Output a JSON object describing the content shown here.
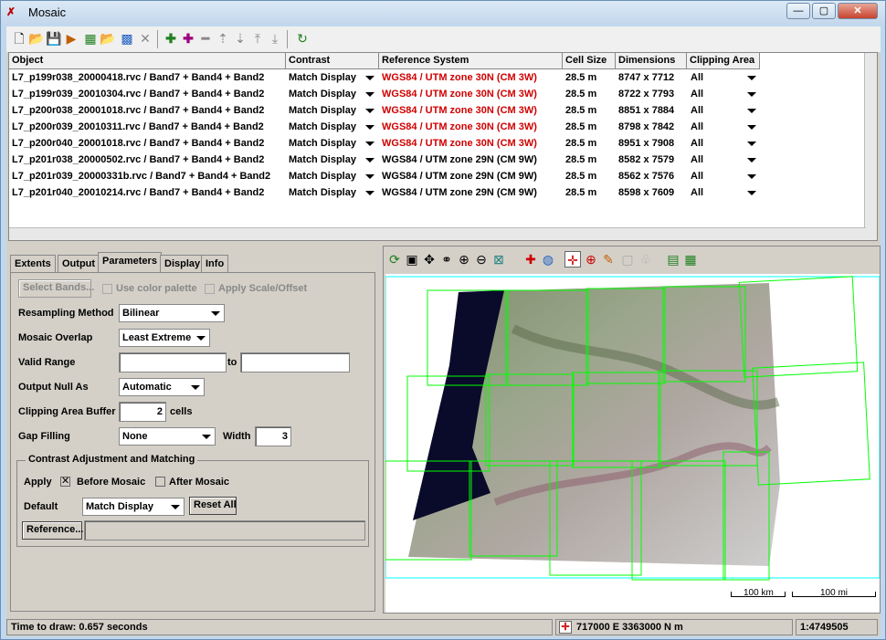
{
  "window": {
    "title": "Mosaic",
    "min": "—",
    "max": "▢",
    "close": "✕"
  },
  "grid": {
    "headers": [
      "Object",
      "Contrast",
      "Reference System",
      "Cell Size",
      "Dimensions",
      "Clipping Area"
    ],
    "rows": [
      {
        "object": "L7_p199r038_20000418.rvc / Band7 + Band4 + Band2",
        "contrast": "Match Display",
        "ref": "WGS84 / UTM zone 30N (CM 3W)",
        "ref_red": true,
        "cell": "28.5 m",
        "dim": "8747 x 7712",
        "clip": "All"
      },
      {
        "object": "L7_p199r039_20010304.rvc / Band7 + Band4 + Band2",
        "contrast": "Match Display",
        "ref": "WGS84 / UTM zone 30N (CM 3W)",
        "ref_red": true,
        "cell": "28.5 m",
        "dim": "8722 x 7793",
        "clip": "All"
      },
      {
        "object": "L7_p200r038_20001018.rvc / Band7 + Band4 + Band2",
        "contrast": "Match Display",
        "ref": "WGS84 / UTM zone 30N (CM 3W)",
        "ref_red": true,
        "cell": "28.5 m",
        "dim": "8851 x 7884",
        "clip": "All"
      },
      {
        "object": "L7_p200r039_20010311.rvc / Band7 + Band4 + Band2",
        "contrast": "Match Display",
        "ref": "WGS84 / UTM zone 30N (CM 3W)",
        "ref_red": true,
        "cell": "28.5 m",
        "dim": "8798 x 7842",
        "clip": "All"
      },
      {
        "object": "L7_p200r040_20001018.rvc / Band7 + Band4 + Band2",
        "contrast": "Match Display",
        "ref": "WGS84 / UTM zone 30N (CM 3W)",
        "ref_red": true,
        "cell": "28.5 m",
        "dim": "8951 x 7908",
        "clip": "All"
      },
      {
        "object": "L7_p201r038_20000502.rvc / Band7 + Band4 + Band2",
        "contrast": "Match Display",
        "ref": "WGS84 / UTM zone 29N (CM 9W)",
        "ref_red": false,
        "cell": "28.5 m",
        "dim": "8582 x 7579",
        "clip": "All"
      },
      {
        "object": "L7_p201r039_20000331b.rvc / Band7 + Band4 + Band2",
        "contrast": "Match Display",
        "ref": "WGS84 / UTM zone 29N (CM 9W)",
        "ref_red": false,
        "cell": "28.5 m",
        "dim": "8562 x 7576",
        "clip": "All"
      },
      {
        "object": "L7_p201r040_20010214.rvc / Band7 + Band4 + Band2",
        "contrast": "Match Display",
        "ref": "WGS84 / UTM zone 29N (CM 9W)",
        "ref_red": false,
        "cell": "28.5 m",
        "dim": "8598 x 7609",
        "clip": "All"
      }
    ]
  },
  "tabs": {
    "extents": "Extents",
    "output": "Output",
    "parameters": "Parameters",
    "display": "Display",
    "info": "Info"
  },
  "params": {
    "select_bands": "Select Bands...",
    "use_color_palette": "Use color palette",
    "apply_scale": "Apply Scale/Offset",
    "resampling_label": "Resampling Method",
    "resampling_value": "Bilinear",
    "overlap_label": "Mosaic Overlap",
    "overlap_value": "Least Extreme",
    "valid_range_label": "Valid Range",
    "to_label": "to",
    "null_label": "Output Null As",
    "null_value": "Automatic",
    "clip_buffer_label": "Clipping Area Buffer",
    "clip_buffer_value": "2",
    "cells_label": "cells",
    "gap_label": "Gap Filling",
    "gap_value": "None",
    "width_label": "Width",
    "width_value": "3"
  },
  "contrast_group": {
    "title": "Contrast Adjustment and Matching",
    "apply_label": "Apply",
    "before_mosaic": "Before Mosaic",
    "before_checked": true,
    "after_mosaic": "After Mosaic",
    "after_checked": false,
    "default_label": "Default",
    "default_value": "Match Display",
    "reset_all": "Reset All",
    "reference_button": "Reference..."
  },
  "view": {
    "scale_km": "100 km",
    "scale_mi": "100 mi"
  },
  "status": {
    "draw_time": "Time to draw: 0.657 seconds",
    "coords": "717000 E  3363000 N m",
    "scale": "1:4749505"
  },
  "colors": {
    "red_ref": "#d00000",
    "footprint": "#00ff00",
    "extent_box": "#00ffff"
  }
}
